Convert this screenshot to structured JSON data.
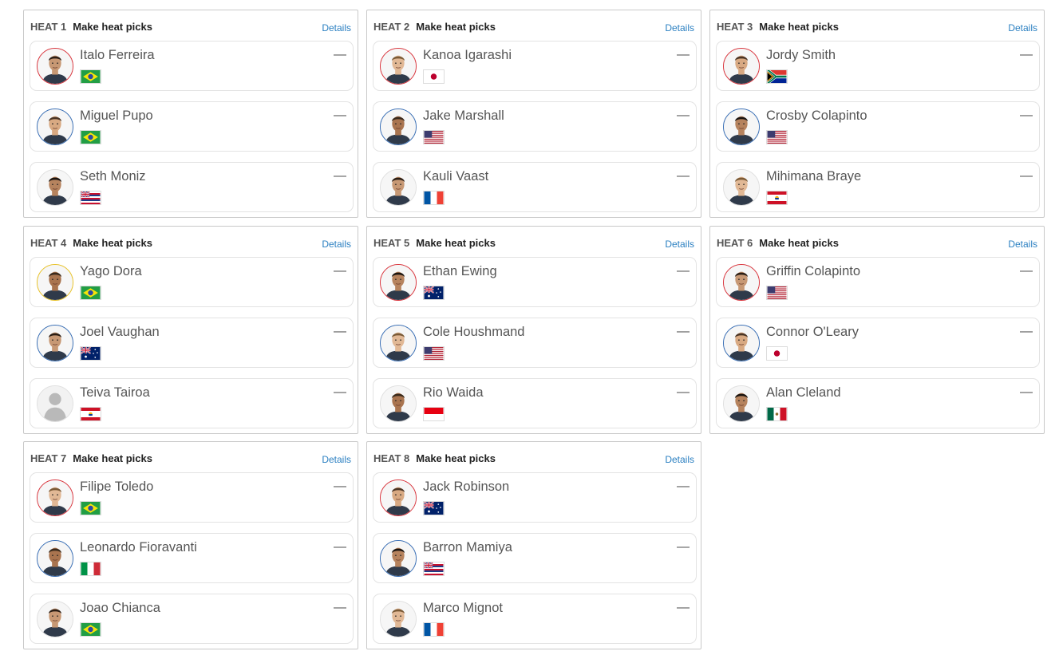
{
  "heat_label_picks": "Make heat picks",
  "details_label": "Details",
  "dash": "—",
  "heats": [
    {
      "label": "HEAT 1",
      "surfers": [
        {
          "name": "Italo Ferreira",
          "flag": "brazil-flag-icon",
          "ring": "red"
        },
        {
          "name": "Miguel Pupo",
          "flag": "brazil-flag-icon",
          "ring": "blue"
        },
        {
          "name": "Seth Moniz",
          "flag": "hawaii-flag-icon",
          "ring": "none"
        }
      ]
    },
    {
      "label": "HEAT 2",
      "surfers": [
        {
          "name": "Kanoa Igarashi",
          "flag": "japan-flag-icon",
          "ring": "red"
        },
        {
          "name": "Jake Marshall",
          "flag": "usa-flag-icon",
          "ring": "blue"
        },
        {
          "name": "Kauli Vaast",
          "flag": "france-flag-icon",
          "ring": "none"
        }
      ]
    },
    {
      "label": "HEAT 3",
      "surfers": [
        {
          "name": "Jordy Smith",
          "flag": "south-africa-flag-icon",
          "ring": "red"
        },
        {
          "name": "Crosby Colapinto",
          "flag": "usa-flag-icon",
          "ring": "blue"
        },
        {
          "name": "Mihimana Braye",
          "flag": "french-polynesia-flag-icon",
          "ring": "none"
        }
      ]
    },
    {
      "label": "HEAT 4",
      "surfers": [
        {
          "name": "Yago Dora",
          "flag": "brazil-flag-icon",
          "ring": "yellow"
        },
        {
          "name": "Joel Vaughan",
          "flag": "australia-flag-icon",
          "ring": "blue"
        },
        {
          "name": "Teiva Tairoa",
          "flag": "french-polynesia-flag-icon",
          "ring": "none",
          "placeholder": true
        }
      ]
    },
    {
      "label": "HEAT 5",
      "surfers": [
        {
          "name": "Ethan Ewing",
          "flag": "australia-flag-icon",
          "ring": "red"
        },
        {
          "name": "Cole Houshmand",
          "flag": "usa-flag-icon",
          "ring": "blue"
        },
        {
          "name": "Rio Waida",
          "flag": "indonesia-flag-icon",
          "ring": "none"
        }
      ]
    },
    {
      "label": "HEAT 6",
      "surfers": [
        {
          "name": "Griffin Colapinto",
          "flag": "usa-flag-icon",
          "ring": "red"
        },
        {
          "name": "Connor O'Leary",
          "flag": "japan-flag-icon",
          "ring": "blue"
        },
        {
          "name": "Alan Cleland",
          "flag": "mexico-flag-icon",
          "ring": "none"
        }
      ]
    },
    {
      "label": "HEAT 7",
      "surfers": [
        {
          "name": "Filipe Toledo",
          "flag": "brazil-flag-icon",
          "ring": "red"
        },
        {
          "name": "Leonardo Fioravanti",
          "flag": "italy-flag-icon",
          "ring": "blue"
        },
        {
          "name": "Joao Chianca",
          "flag": "brazil-flag-icon",
          "ring": "none"
        }
      ]
    },
    {
      "label": "HEAT 8",
      "surfers": [
        {
          "name": "Jack Robinson",
          "flag": "australia-flag-icon",
          "ring": "red"
        },
        {
          "name": "Barron Mamiya",
          "flag": "hawaii-flag-icon",
          "ring": "blue"
        },
        {
          "name": "Marco Mignot",
          "flag": "france-flag-icon",
          "ring": "none"
        }
      ]
    }
  ],
  "colors": {
    "details_link": "#2a7fc1",
    "ring_red": "#d9363e",
    "ring_blue": "#3a6fb5",
    "ring_yellow": "#e8c22a"
  }
}
